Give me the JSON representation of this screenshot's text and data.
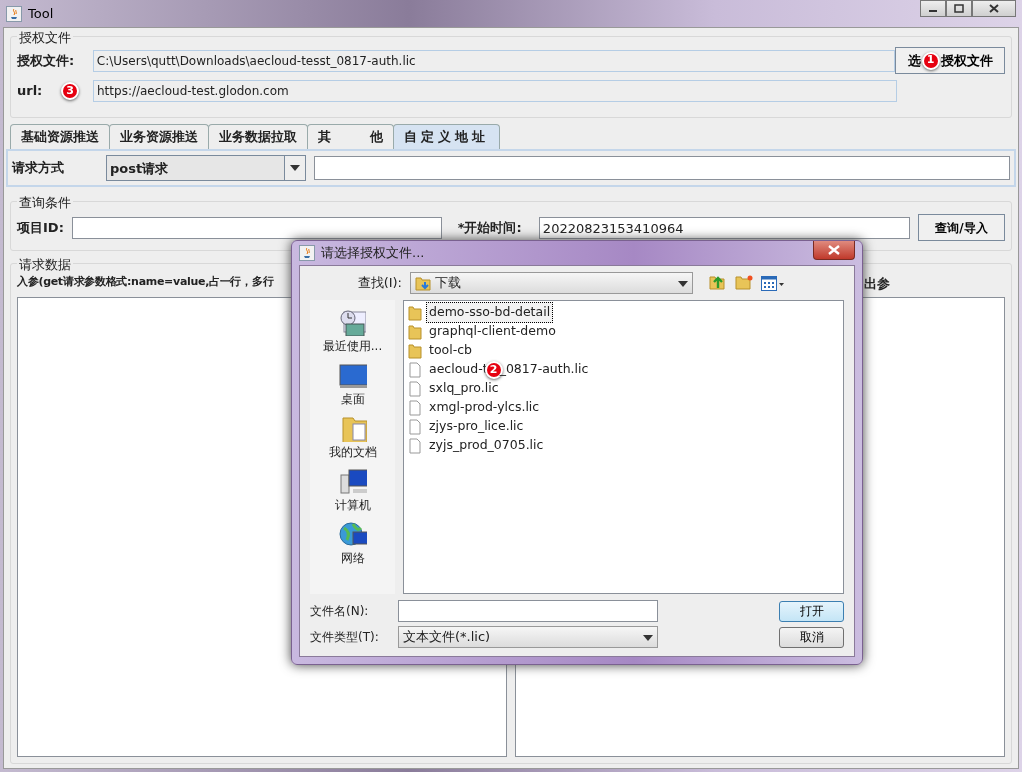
{
  "window": {
    "title": "Tool"
  },
  "license_group": {
    "title": "授权文件",
    "file_label": "授权文件:",
    "file_value": "C:\\Users\\qutt\\Downloads\\aecloud-tesst_0817-auth.lic",
    "url_label": "url:",
    "url_value": "https://aecloud-test.glodon.com",
    "choose_button_parts": [
      "选",
      "授权文件"
    ]
  },
  "annotations": [
    {
      "text": "1"
    },
    {
      "text": "2"
    },
    {
      "text": "3"
    }
  ],
  "tabs": [
    {
      "label": "基础资源推送",
      "selected": false
    },
    {
      "label": "业务资源推送",
      "selected": false
    },
    {
      "label": "业务数据拉取",
      "selected": false
    },
    {
      "label": "其　　　他",
      "selected": false
    },
    {
      "label": "自定义地址",
      "selected": true
    }
  ],
  "request": {
    "method_label": "请求方式",
    "method_value": "post请求"
  },
  "query_group": {
    "title": "查询条件",
    "project_label": "项目ID:",
    "start_label": "*开始时间:",
    "start_value": "20220823153410964",
    "button": "查询/导入"
  },
  "data_group": {
    "title": "请求数据",
    "input_label": "入参(get请求参数格式:name=value,占一行，多行",
    "output_label": "出参"
  },
  "dialog": {
    "title": "请选择授权文件...",
    "look_in_label": "查找(I):",
    "look_in_value": "下载",
    "places": [
      {
        "label": "最近使用...",
        "kind": "recent"
      },
      {
        "label": "桌面",
        "kind": "desktop"
      },
      {
        "label": "我的文档",
        "kind": "documents"
      },
      {
        "label": "计算机",
        "kind": "computer"
      },
      {
        "label": "网络",
        "kind": "network"
      }
    ],
    "files": [
      {
        "name": "demo-sso-bd-detail",
        "kind": "folder",
        "selected": true
      },
      {
        "name": "graphql-client-demo",
        "kind": "folder",
        "selected": false
      },
      {
        "name": "tool-cb",
        "kind": "folder",
        "selected": false
      },
      {
        "name_parts": [
          "aecloud-t",
          "_0817-auth.lic"
        ],
        "kind": "file",
        "selected": false
      },
      {
        "name": "sxlq_pro.lic",
        "kind": "file",
        "selected": false
      },
      {
        "name": "xmgl-prod-ylcs.lic",
        "kind": "file",
        "selected": false
      },
      {
        "name": "zjys-pro_lice.lic",
        "kind": "file",
        "selected": false
      },
      {
        "name": "zyjs_prod_0705.lic",
        "kind": "file",
        "selected": false
      }
    ],
    "filename_label": "文件名(N):",
    "filetype_label": "文件类型(T):",
    "filetype_value": "文本文件(*.lic)",
    "open_button": "打开",
    "cancel_button": "取消"
  }
}
